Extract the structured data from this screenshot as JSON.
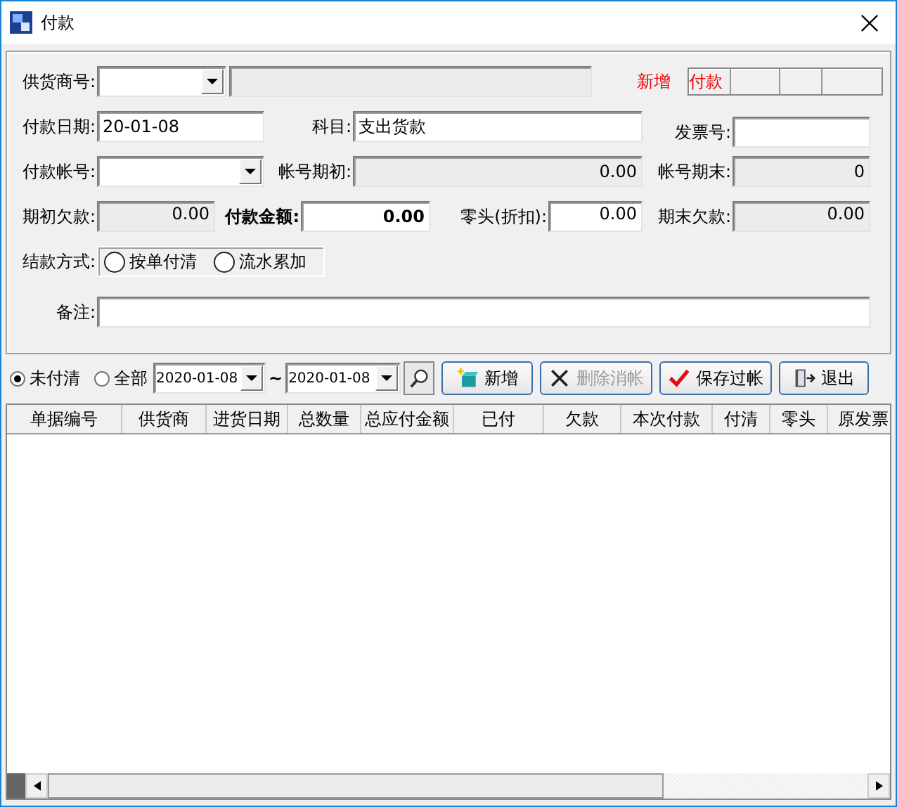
{
  "window": {
    "title": "付款"
  },
  "form": {
    "supplier_no": {
      "label": "供货商号:"
    },
    "mode": "新增",
    "doc_type": "付款",
    "pay_date": {
      "label": "付款日期:",
      "value": "20-01-08"
    },
    "subject": {
      "label": "科目:",
      "value": "支出货款"
    },
    "invoice_no": {
      "label": "发票号:"
    },
    "pay_account": {
      "label": "付款帐号:"
    },
    "account_open": {
      "label": "帐号期初:",
      "value": "0.00"
    },
    "account_close": {
      "label": "帐号期末:",
      "value": "0"
    },
    "opening_debt": {
      "label": "期初欠款:",
      "value": "0.00"
    },
    "pay_amount": {
      "label": "付款金额:",
      "value": "0.00"
    },
    "rounding": {
      "label": "零头(折扣):",
      "value": "0.00"
    },
    "closing_debt": {
      "label": "期末欠款:",
      "value": "0.00"
    },
    "settlement": {
      "label": "结款方式:",
      "options": [
        {
          "label": "按单付清",
          "selected": false
        },
        {
          "label": "流水累加",
          "selected": false
        }
      ]
    },
    "note": {
      "label": "备注:"
    }
  },
  "toolbar": {
    "filter": [
      {
        "label": "未付清",
        "selected": true
      },
      {
        "label": "全部",
        "selected": false
      }
    ],
    "date_from": "2020-01-08",
    "separator": "~",
    "date_to": "2020-01-08",
    "buttons": [
      {
        "label": "新增",
        "kind": "add",
        "disabled": false
      },
      {
        "label": "删除消帐",
        "kind": "delete",
        "disabled": true
      },
      {
        "label": "保存过帐",
        "kind": "save",
        "disabled": false
      },
      {
        "label": "退出",
        "kind": "exit",
        "disabled": false
      }
    ]
  },
  "table": {
    "columns": [
      "单据编号",
      "供货商",
      "进货日期",
      "总数量",
      "总应付金额",
      "已付",
      "欠款",
      "本次付款",
      "付清",
      "零头",
      "原发票"
    ]
  }
}
